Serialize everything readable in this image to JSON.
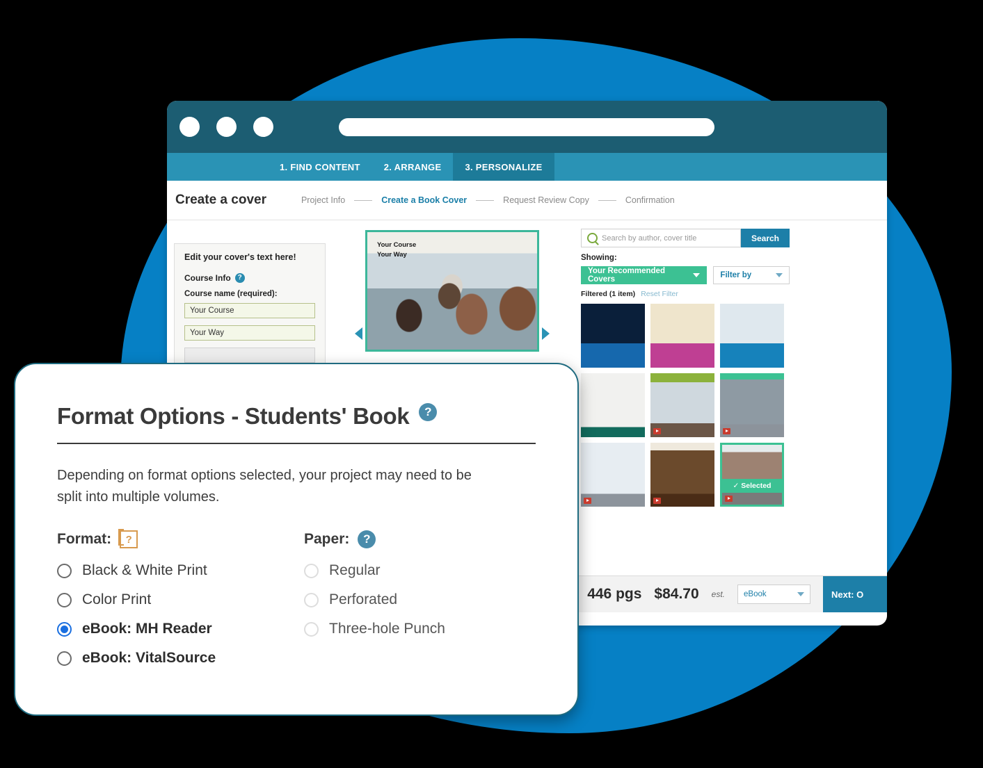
{
  "browser": {
    "dots": [
      "close-dot",
      "minimize-dot",
      "maximize-dot"
    ],
    "url_value": ""
  },
  "steps": [
    {
      "label": "1. FIND CONTENT",
      "active": false
    },
    {
      "label": "2. ARRANGE",
      "active": false
    },
    {
      "label": "3. PERSONALIZE",
      "active": true
    }
  ],
  "breadcrumb": {
    "title": "Create a cover",
    "items": [
      {
        "label": "Project Info",
        "current": false
      },
      {
        "label": "Create a Book Cover",
        "current": true
      },
      {
        "label": "Request Review Copy",
        "current": false
      },
      {
        "label": "Confirmation",
        "current": false
      }
    ]
  },
  "edit_panel": {
    "heading": "Edit your cover's text here!",
    "course_info_label": "Course Info",
    "help_icon": "?",
    "field_label": "Course name (required):",
    "fields": [
      {
        "value": "Your Course"
      },
      {
        "value": "Your Way"
      },
      {
        "value": ""
      }
    ]
  },
  "cover_preview": {
    "line1": "Your Course",
    "line2": "Your Way",
    "prev_icon": "left-arrow-icon",
    "next_icon": "right-arrow-icon"
  },
  "search": {
    "placeholder": "Search by author, cover title",
    "value": "",
    "icon": "search-icon",
    "button_label": "Search"
  },
  "filters": {
    "showing_label": "Showing:",
    "recommended_label": "Your Recommended Covers",
    "filter_by_label": "Filter by",
    "filtered_text": "Filtered (1 item)",
    "reset_label": "Reset Filter"
  },
  "thumbnails": [
    {
      "selected": false,
      "pdf": false
    },
    {
      "selected": false,
      "pdf": false
    },
    {
      "selected": false,
      "pdf": false
    },
    {
      "selected": false,
      "pdf": false
    },
    {
      "selected": false,
      "pdf": true
    },
    {
      "selected": false,
      "pdf": true
    },
    {
      "selected": false,
      "pdf": true
    },
    {
      "selected": false,
      "pdf": true
    },
    {
      "selected": true,
      "pdf": true,
      "badge": "✓ Selected"
    }
  ],
  "bottom_bar": {
    "pages": "446 pgs",
    "price": "$84.70",
    "est": "est.",
    "format_selected": "eBook",
    "next_label": "Next: O"
  },
  "modal": {
    "title": "Format Options - Students' Book",
    "title_help_icon": "?",
    "description": "Depending on format options selected, your project may need to be split into multiple volumes.",
    "format": {
      "label": "Format:",
      "help_icon": "?",
      "options": [
        {
          "label": "Black & White Print",
          "selected": false,
          "disabled": false,
          "bold": false
        },
        {
          "label": "Color Print",
          "selected": false,
          "disabled": false,
          "bold": false
        },
        {
          "label": "eBook: MH Reader",
          "selected": true,
          "disabled": false,
          "bold": true
        },
        {
          "label": "eBook: VitalSource",
          "selected": false,
          "disabled": false,
          "bold": true
        }
      ]
    },
    "paper": {
      "label": "Paper:",
      "help_icon": "?",
      "options": [
        {
          "label": "Regular",
          "selected": false,
          "disabled": true,
          "bold": false
        },
        {
          "label": "Perforated",
          "selected": false,
          "disabled": true,
          "bold": false
        },
        {
          "label": "Three-hole Punch",
          "selected": false,
          "disabled": true,
          "bold": false
        }
      ]
    }
  },
  "colors": {
    "blob_blue": "#0680c5",
    "chrome_teal": "#1c5d72",
    "tab_teal": "#2a93b5",
    "accent_blue": "#1d7fa8",
    "green": "#3cc193",
    "radio_blue": "#1a6fe0",
    "help_blue": "#4a8cab",
    "help_orange": "#d89a4e"
  }
}
